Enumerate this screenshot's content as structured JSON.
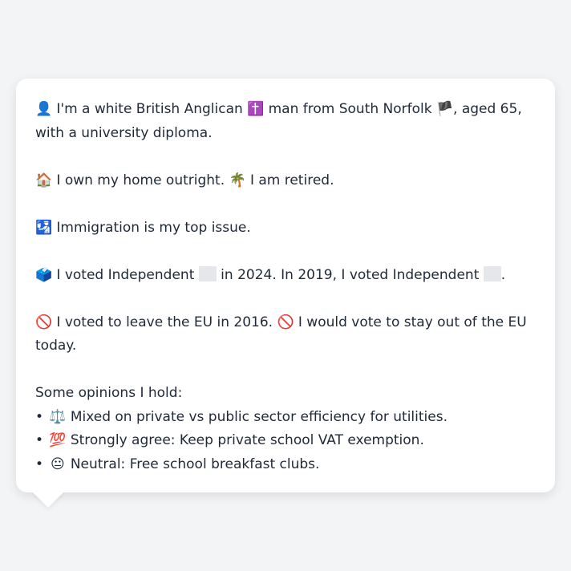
{
  "bio": {
    "icon": "👤",
    "text1": "I'm a white British Anglican",
    "icon2": "✝️",
    "text2": "man from South Norfolk",
    "flag": "🏴",
    "text3": ", aged 65, with a university diploma."
  },
  "home": {
    "icon": "🏠",
    "text1": "I own my home outright.",
    "icon2": "🌴",
    "text2": "I am retired."
  },
  "issue": {
    "icon": "🛂",
    "text": "Immigration is my top issue."
  },
  "vote": {
    "icon": "🗳️",
    "text1": "I voted Independent",
    "text2": "in 2024. In 2019, I voted Independent",
    "text3": "."
  },
  "eu": {
    "icon": "🚫",
    "text1": "I voted to leave the EU in 2016.",
    "icon2": "🚫",
    "text2": "I would vote to stay out of the EU today."
  },
  "opinions": {
    "title": "Some opinions I hold:",
    "bullet": "•",
    "items": [
      {
        "icon": "⚖️",
        "text": "Mixed on private vs public sector efficiency for utilities."
      },
      {
        "icon": "💯",
        "text": "Strongly agree: Keep private school VAT exemption."
      },
      {
        "icon": "😐",
        "text": "Neutral: Free school breakfast clubs."
      }
    ]
  }
}
